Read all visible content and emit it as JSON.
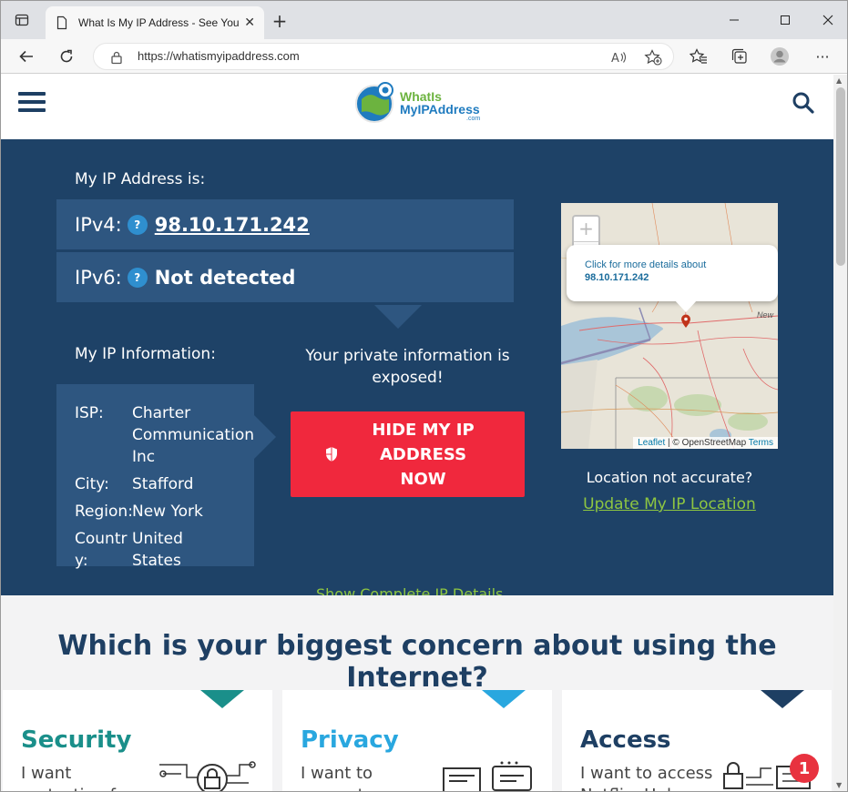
{
  "browser": {
    "tab_title": "What Is My IP Address - See You",
    "url": "https://whatismyipaddress.com"
  },
  "site": {
    "logo_line1": "WhatIs",
    "logo_line2": "MyIPAddress",
    "logo_line3": ".com"
  },
  "hero": {
    "my_ip_heading": "My IP Address is:",
    "ipv4_label": "IPv4:",
    "ipv4_value": "98.10.171.242",
    "ipv6_label": "IPv6:",
    "ipv6_value": "Not detected",
    "help_glyph": "?",
    "info_heading": "My IP Information:",
    "isp_label": "ISP:",
    "isp_value": "Charter Communications Inc",
    "city_label": "City:",
    "city_value": "Stafford",
    "region_label": "Region:",
    "region_value": "New York",
    "country_label": "Countr y:",
    "country_value": "United States",
    "exposed_text": "Your private information is exposed!",
    "hide_button": "HIDE MY IP ADDRESS NOW",
    "show_details_link": "Show Complete IP Details",
    "location_question": "Location not accurate?",
    "update_location_link": "Update My IP Location"
  },
  "map": {
    "zoom_in": "+",
    "zoom_out": "−",
    "popup_text": "Click for more details about",
    "popup_ip": "98.10.171.242",
    "city_label": "New",
    "attr_leaflet": "Leaflet",
    "attr_sep": " | © OpenStreetMap ",
    "attr_terms": "Terms"
  },
  "concern": {
    "heading": "Which is your biggest concern about using the Internet?",
    "cards": [
      {
        "title": "Security",
        "desc": "I want protection from",
        "color": "#1a8f8a"
      },
      {
        "title": "Privacy",
        "desc": "I want to prevent my",
        "color": "#29a7df"
      },
      {
        "title": "Access",
        "desc": "I want to access Netflix, Hulu",
        "color": "#1e3f63"
      }
    ]
  },
  "notification_count": "1",
  "colors": {
    "hero_bg": "#1e4267",
    "panel": "#2e5680",
    "cta": "#f0283d",
    "link": "#8ec641"
  }
}
